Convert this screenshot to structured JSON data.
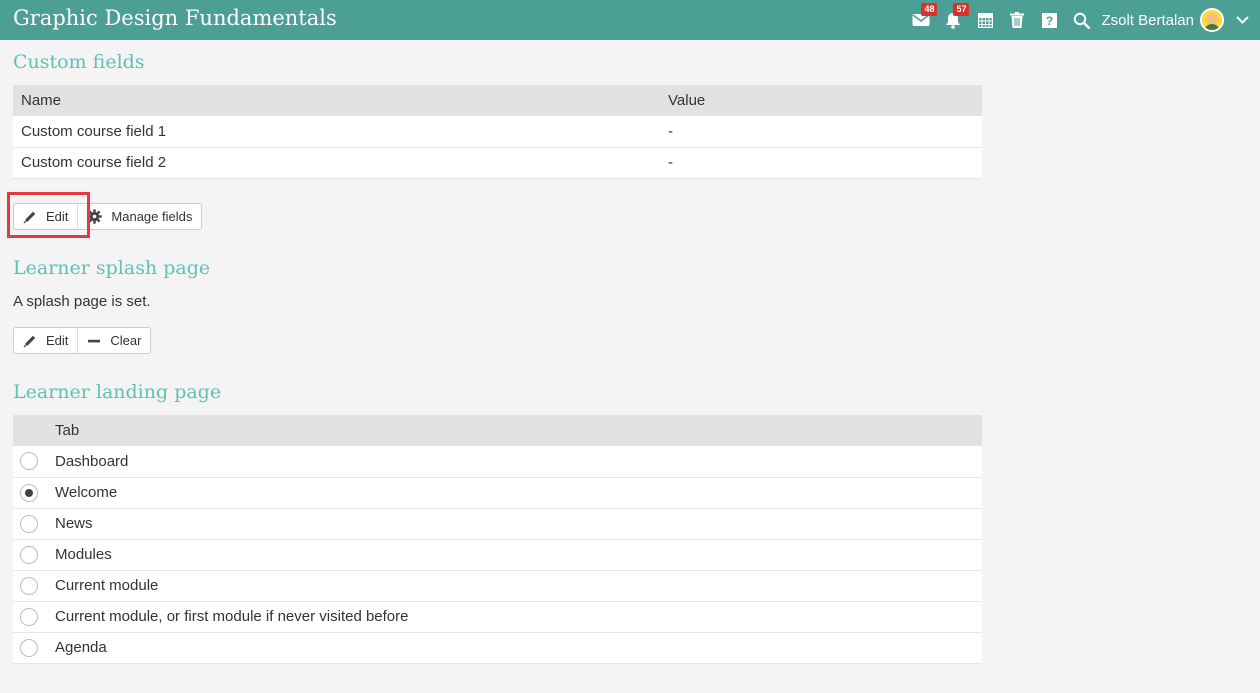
{
  "header": {
    "title": "Graphic Design Fundamentals",
    "messages_count": "48",
    "notifications_count": "57",
    "user_name": "Zsolt Bertalan"
  },
  "custom_fields": {
    "title": "Custom fields",
    "columns": [
      "Name",
      "Value"
    ],
    "rows": [
      {
        "name": "Custom course field 1",
        "value": "-"
      },
      {
        "name": "Custom course field 2",
        "value": "-"
      }
    ],
    "edit_label": "Edit",
    "manage_label": "Manage fields"
  },
  "splash": {
    "title": "Learner splash page",
    "status": "A splash page is set.",
    "edit_label": "Edit",
    "clear_label": "Clear"
  },
  "landing": {
    "title": "Learner landing page",
    "column": "Tab",
    "options": [
      {
        "label": "Dashboard",
        "checked": false
      },
      {
        "label": "Welcome",
        "checked": true
      },
      {
        "label": "News",
        "checked": false
      },
      {
        "label": "Modules",
        "checked": false
      },
      {
        "label": "Current module",
        "checked": false
      },
      {
        "label": "Current module, or first module if never visited before",
        "checked": false
      },
      {
        "label": "Agenda",
        "checked": false
      }
    ]
  },
  "colors": {
    "topbar": "#4c9f95",
    "section_title": "#5fc1b5",
    "badge": "#d9322b",
    "highlight": "#e5393d"
  }
}
